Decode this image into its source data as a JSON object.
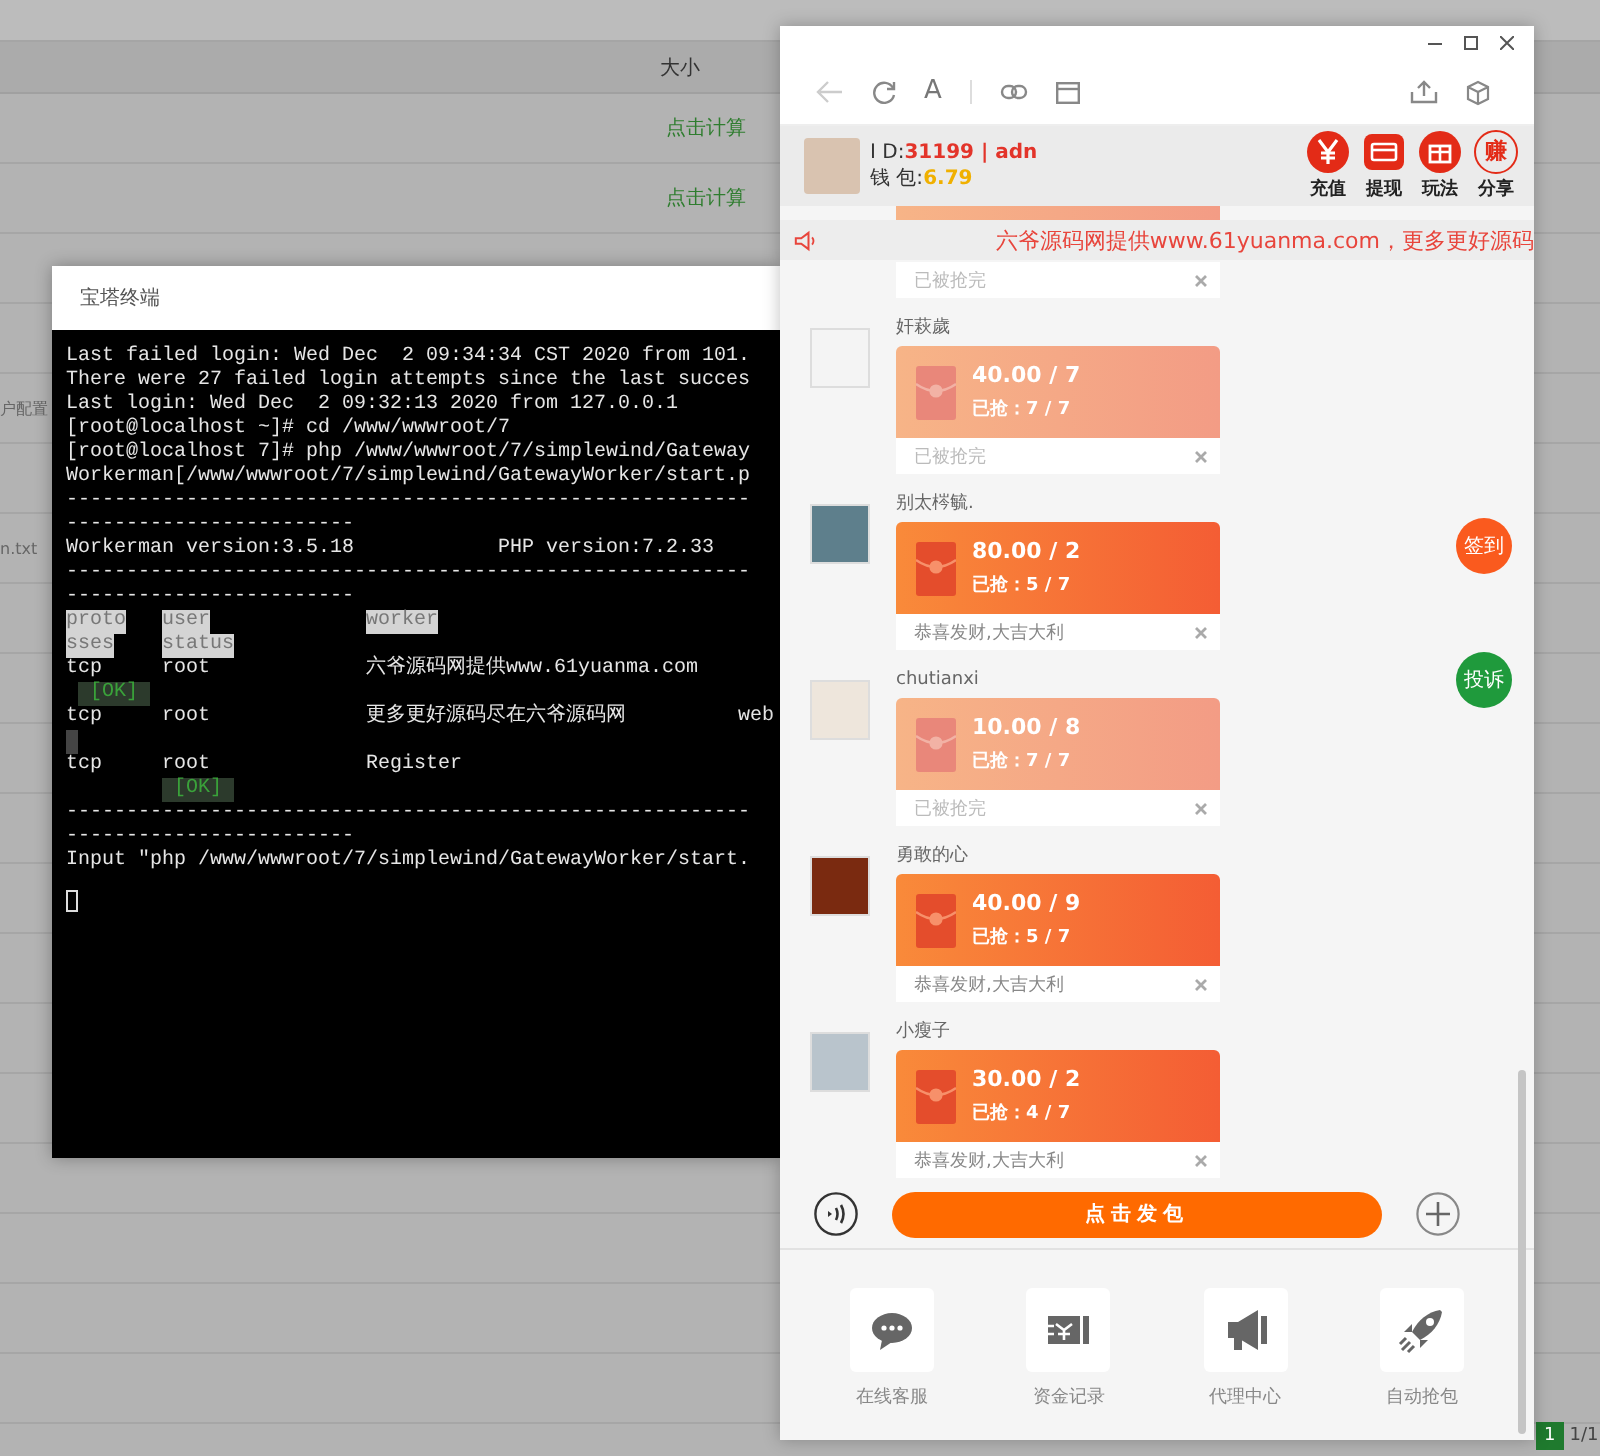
{
  "background": {
    "column_header": "大小",
    "rows": [
      {
        "kind": "size",
        "text": "点击计算"
      },
      {
        "kind": "size",
        "text": "点击计算"
      },
      {
        "kind": "name",
        "text": "户配置"
      },
      {
        "kind": "name",
        "text": "n.txt"
      }
    ],
    "pagination": {
      "current": "1",
      "total": "1/1"
    }
  },
  "terminal": {
    "title": "宝塔终端",
    "lines": [
      {
        "kind": "text",
        "text": "Last failed login: Wed Dec  2 09:34:34 CST 2020 from 101."
      },
      {
        "kind": "text",
        "text": "There were 27 failed login attempts since the last succes"
      },
      {
        "kind": "text",
        "text": "Last login: Wed Dec  2 09:32:13 2020 from 127.0.0.1"
      },
      {
        "kind": "text",
        "text": "[root@localhost ~]# cd /www/wwwroot/7"
      },
      {
        "kind": "text",
        "text": "[root@localhost 7]# php /www/wwwroot/7/simplewind/Gateway"
      },
      {
        "kind": "text",
        "text": "Workerman[/www/wwwroot/7/simplewind/GatewayWorker/start.p"
      },
      {
        "kind": "text",
        "text": "---------------------------------------------------------"
      },
      {
        "kind": "text",
        "text": "------------------------"
      },
      {
        "kind": "split",
        "texts": [
          "Workerman version:3.5.18",
          "PHP version:7.2.33"
        ]
      },
      {
        "kind": "text",
        "text": "---------------------------------------------------------"
      },
      {
        "kind": "text",
        "text": "------------------------"
      },
      {
        "kind": "cells",
        "cells": [
          {
            "kind": "head",
            "text": "proto"
          },
          {
            "kind": "head",
            "text": "user"
          },
          {
            "kind": "head",
            "text": "worker"
          }
        ]
      },
      {
        "kind": "cells",
        "cells": [
          {
            "kind": "head",
            "text": "sses"
          },
          {
            "kind": "head",
            "text": "status"
          }
        ]
      },
      {
        "kind": "cells",
        "cells": [
          {
            "kind": "plain",
            "text": "tcp"
          },
          {
            "kind": "plain",
            "text": "root"
          },
          {
            "kind": "plain",
            "text": "六爷源码网提供www.61yuanma.com"
          }
        ]
      },
      {
        "kind": "cells",
        "cells": [
          {
            "kind": "ok",
            "text": "[OK]"
          }
        ]
      },
      {
        "kind": "cells",
        "cells": [
          {
            "kind": "plain",
            "text": "tcp"
          },
          {
            "kind": "plain",
            "text": "root"
          },
          {
            "kind": "plain",
            "text": "更多更好源码尽在六爷源码网"
          },
          {
            "kind": "plain",
            "text": "web"
          }
        ]
      },
      {
        "kind": "cells",
        "cells": [
          {
            "kind": "block"
          }
        ]
      },
      {
        "kind": "cells",
        "cells": [
          {
            "kind": "plain",
            "text": "tcp"
          },
          {
            "kind": "plain",
            "text": "root"
          },
          {
            "kind": "plain",
            "text": "Register"
          }
        ]
      },
      {
        "kind": "cells",
        "cells": [
          null,
          {
            "kind": "ok",
            "text": "[OK]"
          }
        ]
      },
      {
        "kind": "text",
        "text": "---------------------------------------------------------"
      },
      {
        "kind": "text",
        "text": "------------------------"
      },
      {
        "kind": "text",
        "text": "Input \"php /www/wwwroot/7/simplewind/GatewayWorker/start."
      },
      {
        "kind": "cursor"
      }
    ]
  },
  "phone": {
    "toolbar": {
      "reader_glyph": "A"
    },
    "header": {
      "id_label": "I D:",
      "id_value": "31199 | adn",
      "wallet_label": "钱 包:",
      "wallet_value": "6.79",
      "actions": [
        {
          "kind": "recharge",
          "label": "充值"
        },
        {
          "kind": "withdraw",
          "label": "提现"
        },
        {
          "kind": "rules",
          "label": "玩法"
        },
        {
          "kind": "share",
          "label": "分享",
          "glyph": "赚"
        }
      ]
    },
    "notice": "六爷源码网提供www.61yuanma.com，更多更好源码",
    "messages": [
      {
        "kind": "cut",
        "footer": "已被抢完",
        "finished": true
      },
      {
        "kind": "packet",
        "name": "奸萩歲",
        "amount": "40.00 / 7",
        "grabbed": "已抢：7 / 7",
        "footer": "已被抢完",
        "finished": true
      },
      {
        "kind": "packet",
        "name": "别太梣毓.",
        "amount": "80.00 / 2",
        "grabbed": "已抢：5 / 7",
        "footer": "恭喜发财,大吉大利",
        "finished": false
      },
      {
        "kind": "packet",
        "name": "chutianxi",
        "amount": "10.00 / 8",
        "grabbed": "已抢：7 / 7",
        "footer": "已被抢完",
        "finished": true
      },
      {
        "kind": "packet",
        "name": "勇敢的心",
        "amount": "40.00 / 9",
        "grabbed": "已抢：5 / 7",
        "footer": "恭喜发财,大吉大利",
        "finished": false
      },
      {
        "kind": "packet",
        "name": "小瘦子",
        "amount": "30.00 / 2",
        "grabbed": "已抢：4 / 7",
        "footer": "恭喜发财,大吉大利",
        "finished": false
      }
    ],
    "floating_buttons": [
      {
        "label": "签到",
        "color": "#fa5a1e"
      },
      {
        "label": "投诉",
        "color": "#1f9a3c"
      }
    ],
    "send_button": "点击发包",
    "menu": [
      {
        "kind": "chat",
        "label": "在线客服"
      },
      {
        "kind": "ledger",
        "label": "资金记录"
      },
      {
        "kind": "megaphone",
        "label": "代理中心"
      },
      {
        "kind": "rocket",
        "label": "自动抢包"
      }
    ]
  }
}
